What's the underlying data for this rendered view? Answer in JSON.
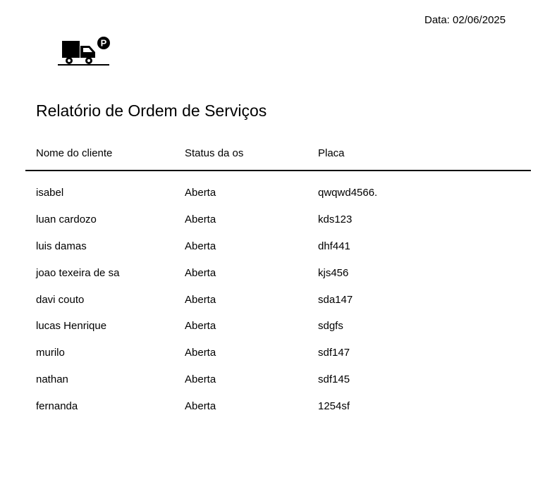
{
  "header": {
    "date": "Data: 02/06/2025"
  },
  "report": {
    "title": "Relatório de Ordem de Serviços",
    "columns": [
      "Nome do cliente",
      "Status da os",
      "Placa"
    ],
    "rows": [
      {
        "cliente": "isabel",
        "status": "Aberta",
        "placa": "qwqwd4566."
      },
      {
        "cliente": "luan cardozo",
        "status": "Aberta",
        "placa": "kds123"
      },
      {
        "cliente": "luis damas",
        "status": "Aberta",
        "placa": "dhf441"
      },
      {
        "cliente": "joao texeira de sa",
        "status": "Aberta",
        "placa": "kjs456"
      },
      {
        "cliente": "davi couto",
        "status": "Aberta",
        "placa": "sda147"
      },
      {
        "cliente": "lucas Henrique",
        "status": "Aberta",
        "placa": "sdgfs"
      },
      {
        "cliente": "murilo",
        "status": "Aberta",
        "placa": "sdf147"
      },
      {
        "cliente": "nathan",
        "status": "Aberta",
        "placa": "sdf145"
      },
      {
        "cliente": "fernanda",
        "status": "Aberta",
        "placa": "1254sf"
      }
    ]
  },
  "logo": {
    "icon": "truck-parking-icon",
    "badge": "P",
    "color": "#000000"
  }
}
